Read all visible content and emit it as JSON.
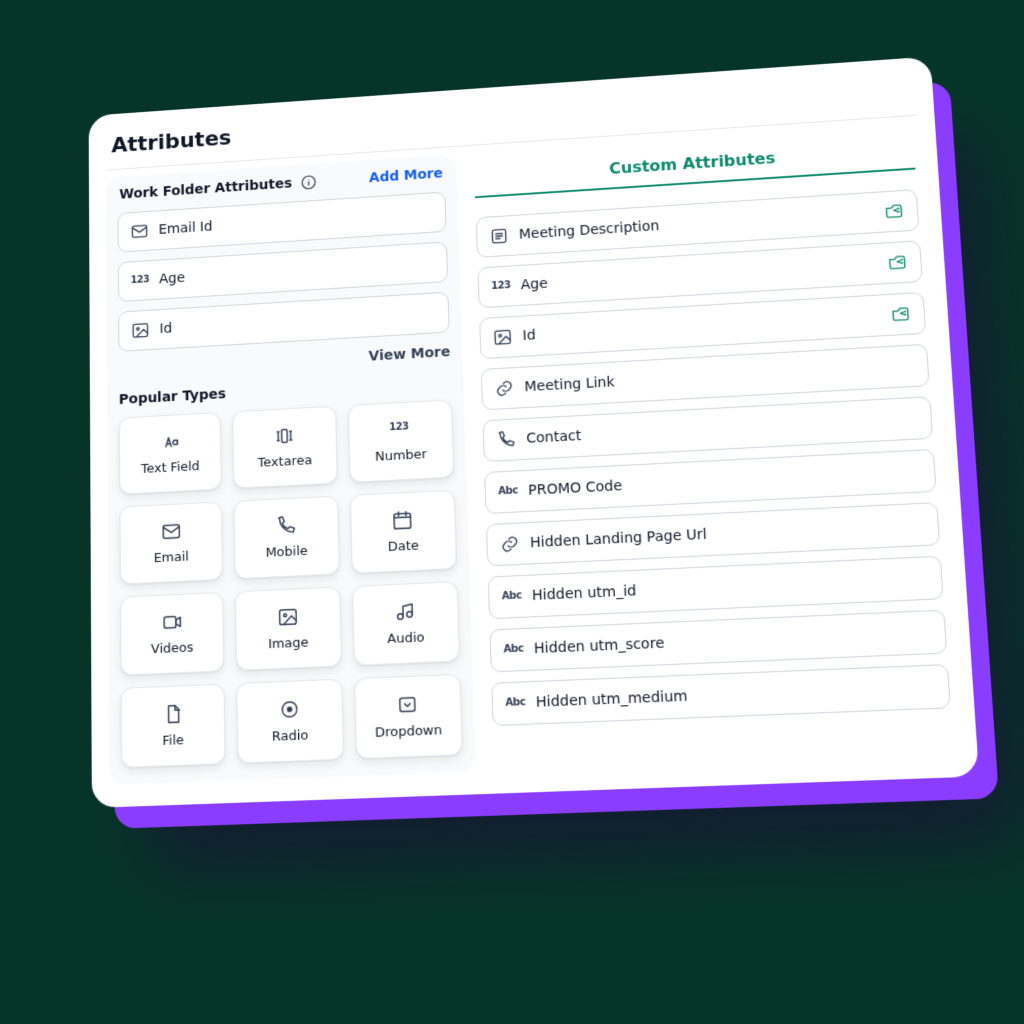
{
  "page": {
    "title": "Attributes"
  },
  "left": {
    "header": "Work Folder Attributes",
    "add_more": "Add More",
    "view_more": "View More",
    "attrs": [
      {
        "icon": "mail",
        "label": "Email Id"
      },
      {
        "icon": "num",
        "label": "Age"
      },
      {
        "icon": "image",
        "label": "Id"
      }
    ],
    "popular_title": "Popular Types",
    "types": [
      {
        "icon": "text",
        "label": "Text Field"
      },
      {
        "icon": "textarea",
        "label": "Textarea"
      },
      {
        "icon": "num",
        "label": "Number"
      },
      {
        "icon": "mail",
        "label": "Email"
      },
      {
        "icon": "phone",
        "label": "Mobile"
      },
      {
        "icon": "date",
        "label": "Date"
      },
      {
        "icon": "video",
        "label": "Videos"
      },
      {
        "icon": "image",
        "label": "Image"
      },
      {
        "icon": "audio",
        "label": "Audio"
      },
      {
        "icon": "file",
        "label": "File"
      },
      {
        "icon": "radio",
        "label": "Radio"
      },
      {
        "icon": "dropdown",
        "label": "Dropdown"
      }
    ]
  },
  "right": {
    "header": "Custom Attributes",
    "attrs": [
      {
        "icon": "desc",
        "label": "Meeting Description",
        "share": true
      },
      {
        "icon": "num",
        "label": "Age",
        "share": true
      },
      {
        "icon": "image",
        "label": "Id",
        "share": true
      },
      {
        "icon": "link",
        "label": "Meeting Link",
        "share": false
      },
      {
        "icon": "phone",
        "label": "Contact",
        "share": false
      },
      {
        "icon": "abc",
        "label": "PROMO Code",
        "share": false
      },
      {
        "icon": "link",
        "label": "Hidden Landing Page Url",
        "share": false
      },
      {
        "icon": "abc",
        "label": "Hidden utm_id",
        "share": false
      },
      {
        "icon": "abc",
        "label": "Hidden utm_score",
        "share": false
      },
      {
        "icon": "abc",
        "label": "Hidden utm_medium",
        "share": false
      }
    ]
  },
  "colors": {
    "accent_green": "#0e8a6f",
    "accent_blue": "#155eef",
    "purple": "#8b3dff"
  }
}
